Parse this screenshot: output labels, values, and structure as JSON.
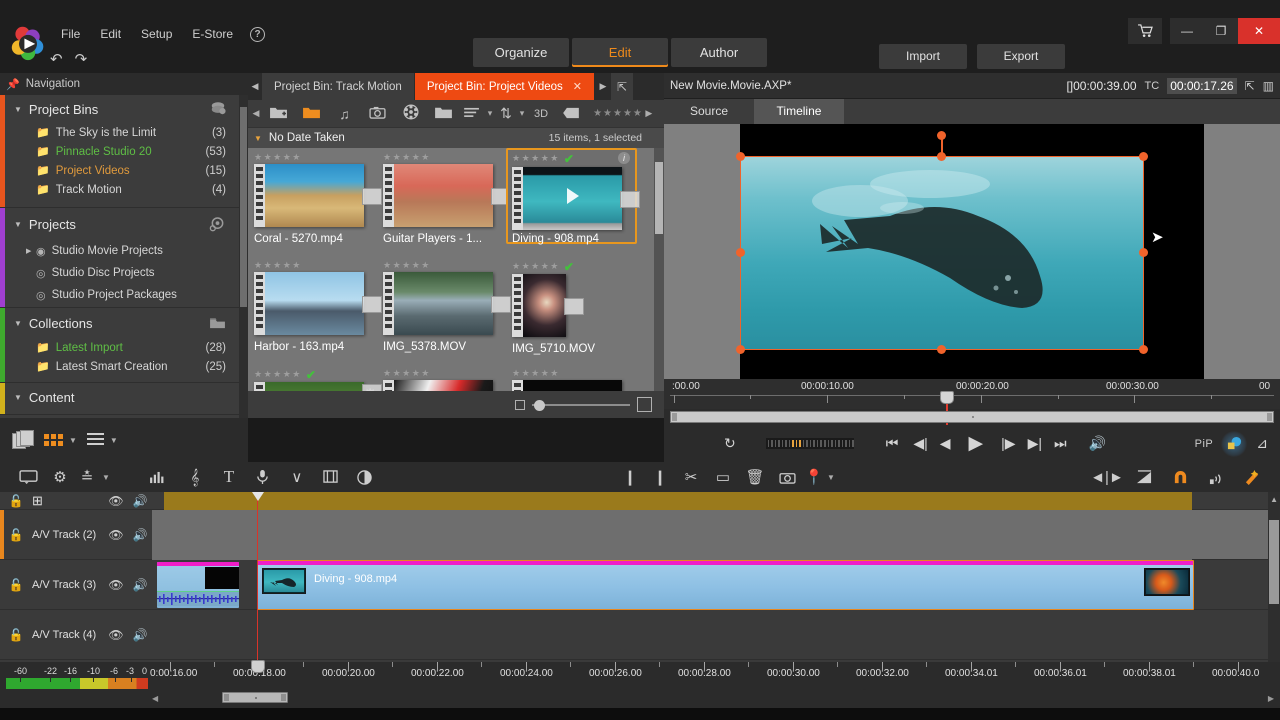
{
  "app": {
    "logo_name": "pinnacle-studio-logo",
    "menu": [
      "File",
      "Edit",
      "Setup",
      "E-Store"
    ],
    "help_glyph": "?",
    "undo_label": "↶",
    "redo_label": "↷"
  },
  "main_tabs": [
    {
      "label": "Organize",
      "active": false
    },
    {
      "label": "Edit",
      "active": true
    },
    {
      "label": "Author",
      "active": false
    }
  ],
  "actions": [
    {
      "label": "Import"
    },
    {
      "label": "Export"
    }
  ],
  "window_controls": {
    "cart": "🛒",
    "minimize": "—",
    "restore": "❐",
    "close": "✕"
  },
  "navigation": {
    "panel_title": "Navigation",
    "sections": [
      {
        "title": "Project Bins",
        "color": "#e8551e",
        "icon": "bins-icon",
        "items": [
          {
            "label": "The Sky is the Limit",
            "count": "(3)",
            "style": "normal",
            "folder": "folder-white"
          },
          {
            "label": "Pinnacle Studio 20",
            "count": "(53)",
            "style": "green",
            "folder": "folder-green"
          },
          {
            "label": "Project Videos",
            "count": "(15)",
            "style": "orange",
            "folder": "folder-orange"
          },
          {
            "label": "Track Motion",
            "count": "(4)",
            "style": "normal",
            "folder": "folder-white"
          }
        ]
      },
      {
        "title": "Projects",
        "color": "#a03fd0",
        "icon": "projects-icon",
        "items": [
          {
            "label": "Studio Movie Projects",
            "count": "",
            "style": "normal",
            "folder": "disc-icon",
            "expandable": true
          },
          {
            "label": "Studio Disc Projects",
            "count": "",
            "style": "normal",
            "folder": "disc-icon"
          },
          {
            "label": "Studio Project Packages",
            "count": "",
            "style": "normal",
            "folder": "disc-icon"
          }
        ]
      },
      {
        "title": "Collections",
        "color": "#3faa2e",
        "icon": "collections-icon",
        "items": [
          {
            "label": "Latest Import",
            "count": "(28)",
            "style": "green",
            "folder": "folder-green"
          },
          {
            "label": "Latest Smart Creation",
            "count": "(25)",
            "style": "normal",
            "folder": "folder-white"
          }
        ]
      },
      {
        "title": "Content",
        "color": "#d1b11c",
        "icon": "",
        "items": []
      }
    ]
  },
  "bin": {
    "tabs": [
      {
        "label": "Project Bin: Track Motion",
        "active": false,
        "closable": false
      },
      {
        "label": "Project Bin: Project Videos",
        "active": true,
        "closable": true,
        "close_glyph": "✕"
      }
    ],
    "toolbar": {
      "icons": [
        "new-bin-icon",
        "open-bin-icon",
        "music-icon",
        "photo-icon",
        "video-icon",
        "folder-icon",
        "list-view-icon",
        "sort-icon"
      ],
      "label_3d": "3D",
      "stars": "★★★★★"
    },
    "group_header": {
      "label": "No Date Taken",
      "status": "15 items, 1 selected"
    },
    "items": [
      {
        "name": "Coral - 5270.mp4",
        "stars": "★★★★★",
        "checked": false,
        "selected": false,
        "pic": "coral"
      },
      {
        "name": "Guitar Players - 1...",
        "stars": "★★★★★",
        "checked": false,
        "selected": false,
        "pic": "guitar"
      },
      {
        "name": "Diving - 908.mp4",
        "stars": "★★★★★",
        "checked": true,
        "selected": true,
        "pic": "diving",
        "info": "i"
      },
      {
        "name": "Harbor - 163.mp4",
        "stars": "★★★★★",
        "checked": false,
        "selected": false,
        "pic": "harbor"
      },
      {
        "name": "IMG_5378.MOV",
        "stars": "★★★★★",
        "checked": false,
        "selected": false,
        "pic": "pier"
      },
      {
        "name": "IMG_5710.MOV",
        "stars": "★★★★★",
        "checked": true,
        "selected": false,
        "pic": "fireworks"
      },
      {
        "name": "",
        "stars": "★★★★★",
        "checked": true,
        "selected": false,
        "pic": "jungle"
      },
      {
        "name": "",
        "stars": "★★★★★",
        "checked": false,
        "selected": false,
        "pic": "santa"
      },
      {
        "name": "",
        "stars": "★★★★★",
        "checked": false,
        "selected": false,
        "pic": "black"
      }
    ],
    "viewbar": {
      "stack_icon": "stack-view-icon",
      "grid_icon": "grid-view-icon",
      "list_icon": "list-view-icon"
    }
  },
  "player": {
    "title": "New Movie.Movie.AXP*",
    "duration_label": "[]00:00:39.00",
    "tc_label": "TC",
    "tc_value": "00:00:17.26",
    "tabs": [
      {
        "label": "Source",
        "active": false
      },
      {
        "label": "Timeline",
        "active": true
      }
    ],
    "ruler_labels": [
      ":00.00",
      "00:00:10.00",
      "00:00:20.00",
      "00:00:30.00",
      "00"
    ],
    "transport": {
      "loop_icon": "loop-icon",
      "start_icon": "go-to-start-icon",
      "prev_icon": "previous-frame-icon",
      "stepback_icon": "step-back-icon",
      "play_icon": "play-icon",
      "stepfwd_icon": "step-forward-icon",
      "next_icon": "next-frame-icon",
      "end_icon": "go-to-end-icon",
      "volume_icon": "volume-icon",
      "pip_label": "PiP"
    }
  },
  "timeline_toolbar": {
    "left_icons": [
      "timeline-settings-icon",
      "gear-icon",
      "track-height-icon"
    ],
    "mid_icons": [
      "audio-mixer-icon",
      "music-icon",
      "title-icon",
      "voiceover-icon",
      "keyframe-icon",
      "storyboard-icon",
      "transition-icon"
    ],
    "edit_icons": [
      "mark-in-icon",
      "mark-out-icon",
      "split-icon",
      "clip-icon",
      "delete-icon",
      "snapshot-icon",
      "marker-icon"
    ],
    "right_icons": [
      "trim-icon",
      "dynamic-length-icon",
      "magnet-icon",
      "scrub-audio-icon",
      "smart-edit-icon"
    ]
  },
  "timeline": {
    "tracks": [
      {
        "name": "A/V Track (2)",
        "locked": false
      },
      {
        "name": "A/V Track (3)",
        "locked": false
      },
      {
        "name": "A/V Track (4)",
        "locked": false
      }
    ],
    "clips": [
      {
        "track": 1,
        "title": "Diving - 908.mp4",
        "selected": true
      }
    ]
  },
  "bottom_ruler": {
    "db_labels": [
      "-60",
      "-22",
      "-16",
      "-10",
      "-6",
      "-3",
      "0"
    ],
    "time_labels": [
      "0:00:16.00",
      "00:00:18.00",
      "00:00:20.00",
      "00:00:22.00",
      "00:00:24.00",
      "00:00:26.00",
      "00:00:28.00",
      "00:00:30.00",
      "00:00:32.00",
      "00:00:34.01",
      "00:00:36.01",
      "00:00:38.01",
      "00:00:40.0"
    ]
  },
  "colors": {
    "accent_orange": "#ee6a1f",
    "tab_active": "#ee4a12",
    "selection": "#e8971e",
    "clip_blue": "#8fc0e8",
    "clip_magenta": "#f01ec8",
    "playhead_red": "#d8342a",
    "track_gold": "#9a7a1c"
  }
}
